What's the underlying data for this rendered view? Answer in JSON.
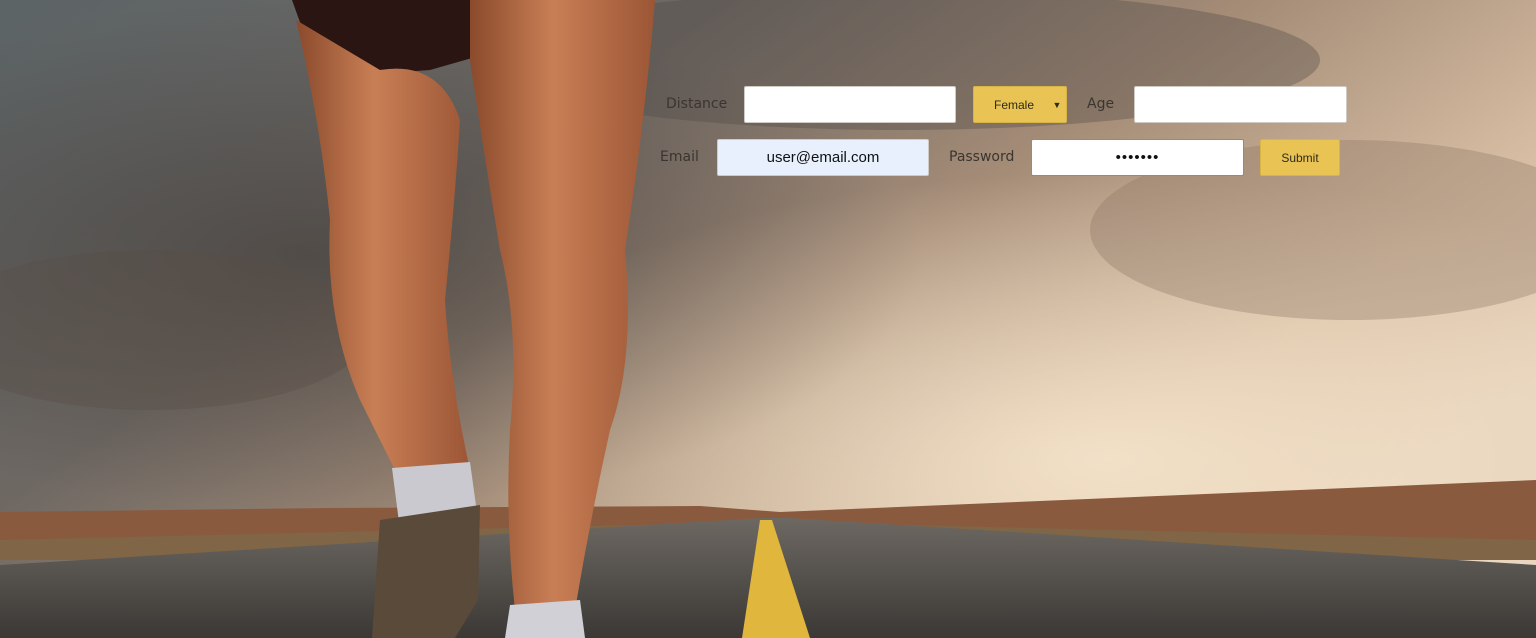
{
  "form": {
    "distance": {
      "label": "Distance",
      "value": ""
    },
    "gender": {
      "selected": "Female",
      "caret_icon": "caret-down-icon"
    },
    "age": {
      "label": "Age",
      "value": ""
    },
    "email": {
      "label": "Email",
      "value": "user@email.com"
    },
    "password": {
      "label": "Password",
      "value": "•••••••"
    },
    "submit": {
      "label": "Submit"
    }
  },
  "colors": {
    "button_bg": "#e9c454",
    "input_bg": "#ffffff",
    "autofill_bg": "#e8f0fe",
    "label_text": "#3a3530"
  }
}
